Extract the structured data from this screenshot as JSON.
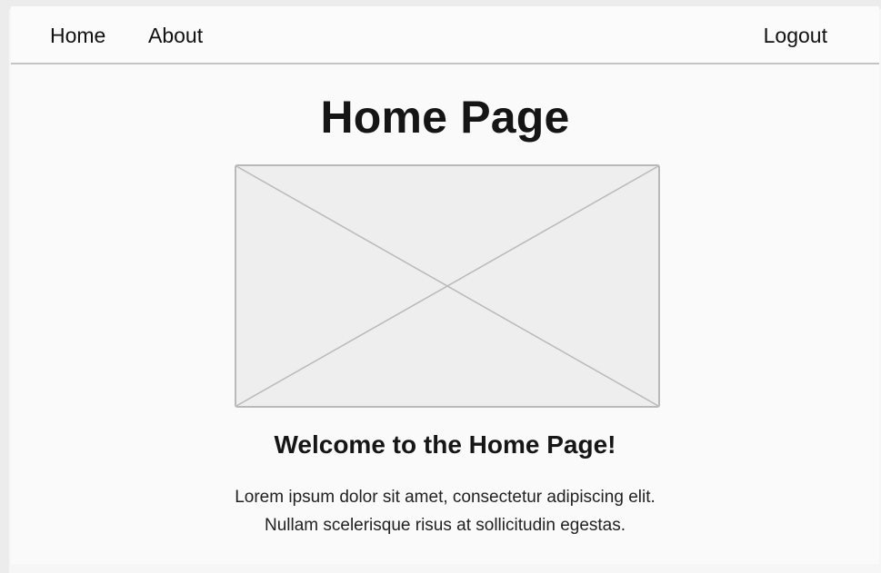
{
  "nav": {
    "home_label": "Home",
    "about_label": "About",
    "logout_label": "Logout"
  },
  "page": {
    "title": "Home Page",
    "welcome_heading": "Welcome to the Home Page!",
    "description_lines": [
      "Lorem ipsum dolor sit amet, consectetur adipiscing elit.",
      "Nullam scelerisque risus at sollicitudin egestas."
    ]
  },
  "colors": {
    "background": "#fafafa",
    "nav_border": "#c4c4c4",
    "placeholder_fill": "#eeeeee",
    "placeholder_stroke": "#b9b9b9",
    "text": "#111111"
  },
  "icons": {
    "hero": "image-placeholder-icon"
  }
}
